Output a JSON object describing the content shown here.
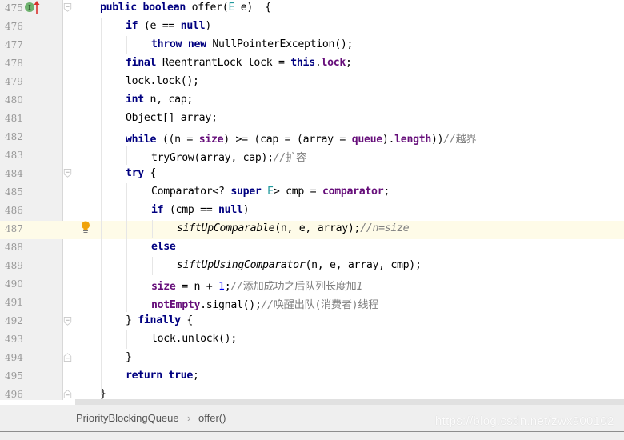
{
  "editor": {
    "current_line": 487,
    "lines": [
      {
        "no": "475",
        "indent": 1,
        "tokens": [
          [
            "kw",
            "public"
          ],
          [
            "",
            " "
          ],
          [
            "kw",
            "boolean"
          ],
          [
            "",
            " offer("
          ],
          [
            "tp",
            "E"
          ],
          [
            "",
            " e)  {"
          ]
        ]
      },
      {
        "no": "476",
        "indent": 2,
        "tokens": [
          [
            "kw",
            "if"
          ],
          [
            "",
            " (e == "
          ],
          [
            "kw",
            "null"
          ],
          [
            "",
            ")"
          ]
        ]
      },
      {
        "no": "477",
        "indent": 3,
        "tokens": [
          [
            "kw",
            "throw"
          ],
          [
            "",
            " "
          ],
          [
            "kw",
            "new"
          ],
          [
            "",
            " NullPointerException();"
          ]
        ]
      },
      {
        "no": "478",
        "indent": 2,
        "tokens": [
          [
            "kw",
            "final"
          ],
          [
            "",
            " ReentrantLock lock = "
          ],
          [
            "kw",
            "this"
          ],
          [
            "",
            "."
          ],
          [
            "fld",
            "lock"
          ],
          [
            "",
            ";"
          ]
        ]
      },
      {
        "no": "479",
        "indent": 2,
        "tokens": [
          [
            "",
            "lock.lock();"
          ]
        ]
      },
      {
        "no": "480",
        "indent": 2,
        "tokens": [
          [
            "kw",
            "int"
          ],
          [
            "",
            " n, cap;"
          ]
        ]
      },
      {
        "no": "481",
        "indent": 2,
        "tokens": [
          [
            "",
            "Object[] array;"
          ]
        ]
      },
      {
        "no": "482",
        "indent": 2,
        "tokens": [
          [
            "kw",
            "while"
          ],
          [
            "",
            " ((n = "
          ],
          [
            "fld",
            "size"
          ],
          [
            "",
            ") >= (cap = (array = "
          ],
          [
            "fld",
            "queue"
          ],
          [
            "",
            ")."
          ],
          [
            "fld",
            "length"
          ],
          [
            "",
            "))"
          ],
          [
            "cmt",
            "//"
          ],
          [
            "cmt-cn",
            "越界"
          ]
        ]
      },
      {
        "no": "483",
        "indent": 3,
        "tokens": [
          [
            "",
            "tryGrow(array, cap);"
          ],
          [
            "cmt",
            "//"
          ],
          [
            "cmt-cn",
            "扩容"
          ]
        ]
      },
      {
        "no": "484",
        "indent": 2,
        "tokens": [
          [
            "kw",
            "try"
          ],
          [
            "",
            " {"
          ]
        ]
      },
      {
        "no": "485",
        "indent": 3,
        "tokens": [
          [
            "",
            "Comparator<? "
          ],
          [
            "kw",
            "super"
          ],
          [
            "",
            " "
          ],
          [
            "tp",
            "E"
          ],
          [
            "",
            "> cmp = "
          ],
          [
            "fld",
            "comparator"
          ],
          [
            "",
            ";"
          ]
        ]
      },
      {
        "no": "486",
        "indent": 3,
        "tokens": [
          [
            "kw",
            "if"
          ],
          [
            "",
            " (cmp == "
          ],
          [
            "kw",
            "null"
          ],
          [
            "",
            ")"
          ]
        ]
      },
      {
        "no": "487",
        "indent": 4,
        "tokens": [
          [
            "it",
            "siftUpComparable"
          ],
          [
            "",
            "(n, e, array);"
          ],
          [
            "cmt",
            "//n=size"
          ]
        ]
      },
      {
        "no": "488",
        "indent": 3,
        "tokens": [
          [
            "kw",
            "else"
          ]
        ]
      },
      {
        "no": "489",
        "indent": 4,
        "tokens": [
          [
            "it",
            "siftUpUsingComparator"
          ],
          [
            "",
            "(n, e, array, cmp);"
          ]
        ]
      },
      {
        "no": "490",
        "indent": 3,
        "tokens": [
          [
            "fld",
            "size"
          ],
          [
            "",
            " = n + "
          ],
          [
            "num",
            "1"
          ],
          [
            "",
            ";"
          ],
          [
            "cmt",
            "//"
          ],
          [
            "cmt-cn",
            "添加成功之后队列长度加"
          ],
          [
            "cmt",
            "1"
          ]
        ]
      },
      {
        "no": "491",
        "indent": 3,
        "tokens": [
          [
            "fld",
            "notEmpty"
          ],
          [
            "",
            ".signal();"
          ],
          [
            "cmt",
            "//"
          ],
          [
            "cmt-cn",
            "唤醒出队(消费者)线程"
          ]
        ]
      },
      {
        "no": "492",
        "indent": 2,
        "tokens": [
          [
            "",
            "} "
          ],
          [
            "kw",
            "finally"
          ],
          [
            "",
            " {"
          ]
        ]
      },
      {
        "no": "493",
        "indent": 3,
        "tokens": [
          [
            "",
            "lock.unlock();"
          ]
        ]
      },
      {
        "no": "494",
        "indent": 2,
        "tokens": [
          [
            "",
            "}"
          ]
        ]
      },
      {
        "no": "495",
        "indent": 2,
        "tokens": [
          [
            "kw",
            "return"
          ],
          [
            "",
            " "
          ],
          [
            "kw",
            "true"
          ],
          [
            "",
            ";"
          ]
        ]
      },
      {
        "no": "496",
        "indent": 1,
        "tokens": [
          [
            "",
            "}"
          ]
        ]
      }
    ],
    "gutter_icons": {
      "implements_marker": "I",
      "implements_line": "475",
      "intention_bulb_line": "487"
    }
  },
  "breadcrumb": {
    "items": [
      "PriorityBlockingQueue",
      "offer()"
    ],
    "separator": "›"
  },
  "watermark": "https://blog.csdn.net/zwx900102",
  "colors": {
    "keyword": "#000080",
    "field": "#660e7a",
    "type_param": "#20999d",
    "number": "#0000ff",
    "comment": "#808080",
    "current_line": "#fefbe8",
    "gutter": "#f0f0f0",
    "bulb": "#f0a30a"
  }
}
